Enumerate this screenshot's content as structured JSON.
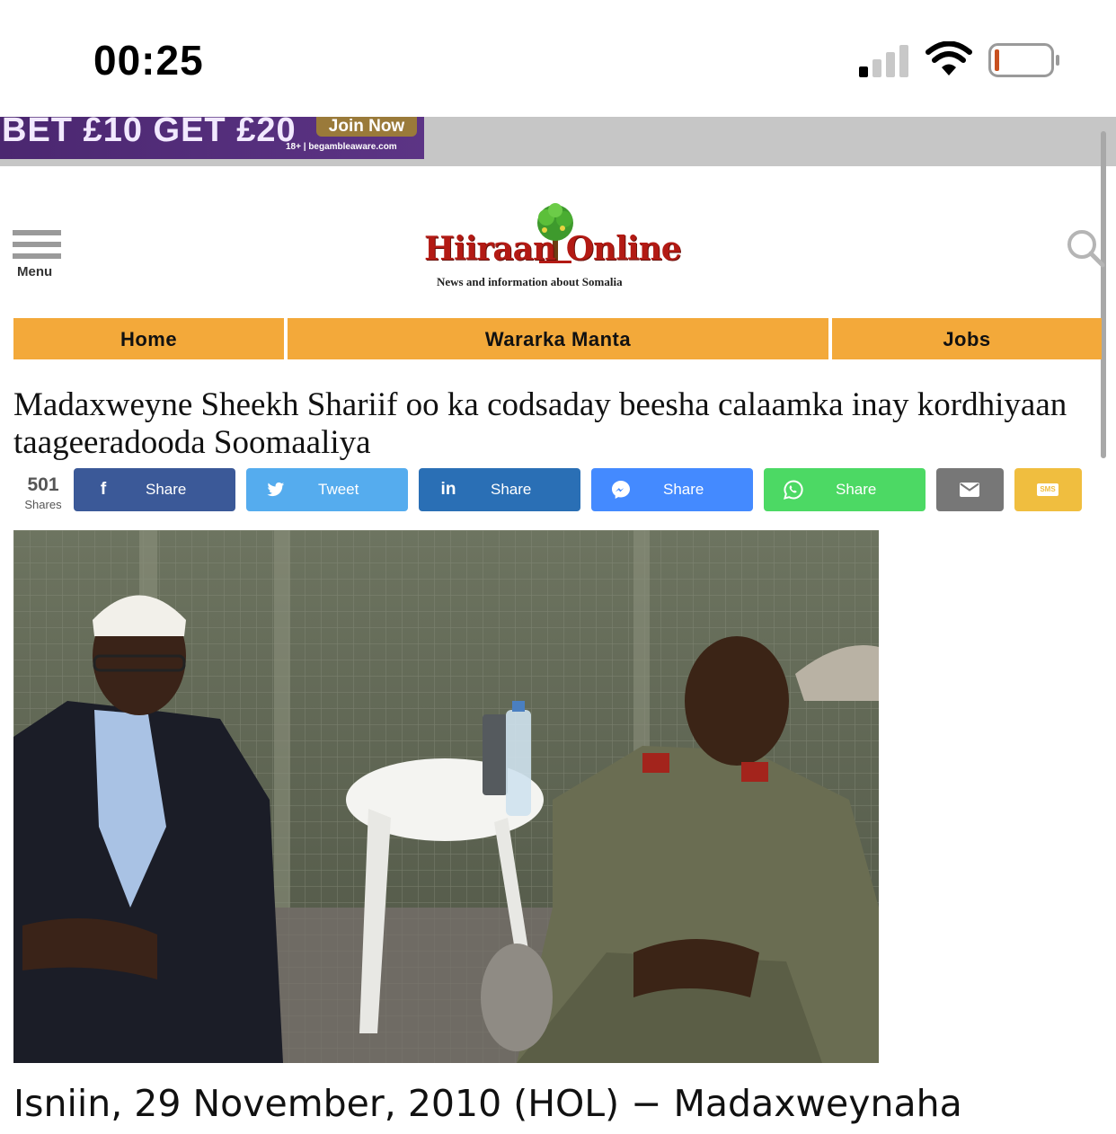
{
  "status": {
    "time": "00:25"
  },
  "ad": {
    "headline": "BET £10 GET £20",
    "cta": "Join Now",
    "fineprint": "18+ | begambleaware.com"
  },
  "header": {
    "menu_label": "Menu",
    "logo_text": "Hiiraan Online",
    "logo_tagline": "News and information about Somalia"
  },
  "nav": {
    "items": [
      {
        "label": "Home"
      },
      {
        "label": "Wararka Manta"
      },
      {
        "label": "Jobs"
      }
    ]
  },
  "article": {
    "title": "Madaxweyne Sheekh Shariif oo ka codsaday beesha calaamka inay kordhiyaan taageeradooda Soomaaliya",
    "lead": "Isniin, 29 November, 2010 (HOL) − Madaxweynaha"
  },
  "share": {
    "count": "501",
    "count_label": "Shares",
    "buttons": [
      {
        "network": "facebook",
        "label": "Share",
        "icon": "f",
        "color": "#3b5998"
      },
      {
        "network": "twitter",
        "label": "Tweet",
        "icon": "twitter-bird",
        "color": "#55acee"
      },
      {
        "network": "linkedin",
        "label": "Share",
        "icon": "in",
        "color": "#2a6fb5"
      },
      {
        "network": "messenger",
        "label": "Share",
        "icon": "messenger",
        "color": "#448aff"
      },
      {
        "network": "whatsapp",
        "label": "Share",
        "icon": "whatsapp",
        "color": "#4cd964"
      },
      {
        "network": "email",
        "label": "",
        "icon": "envelope",
        "color": "#777777"
      },
      {
        "network": "sms",
        "label": "",
        "icon": "SMS",
        "color": "#f0be3f"
      }
    ]
  },
  "colors": {
    "nav": "#f3a93a",
    "logo_red": "#b31a14"
  }
}
